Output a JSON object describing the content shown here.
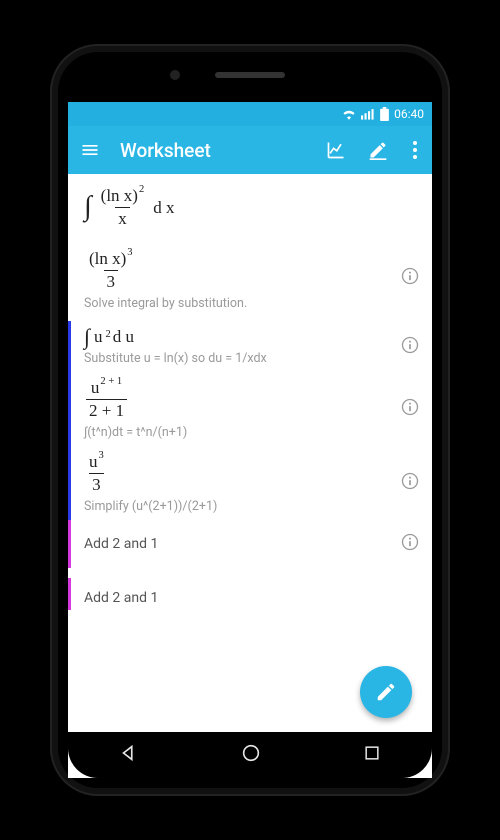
{
  "statusbar": {
    "time": "06:40"
  },
  "appbar": {
    "title": "Worksheet"
  },
  "problem": {
    "int_prefix": "∫",
    "lnx": "(ln x)",
    "exp2": "2",
    "over_x": "x",
    "dx": "d x"
  },
  "answer": {
    "lnx": "(ln x)",
    "exp3": "3",
    "den": "3",
    "hint": "Solve integral by substitution."
  },
  "step1": {
    "int_prefix": "∫",
    "u": "u",
    "exp2": "2",
    "du": "d u",
    "hint": "Substitute u = ln(x) so du = 1/xdx"
  },
  "step2": {
    "u": "u",
    "exp": "2 + 1",
    "den": "2 + 1",
    "hint": "∫(t^n)dt = t^n/(n+1)"
  },
  "step3": {
    "u": "u",
    "exp": "3",
    "den": "3",
    "hint": "Simplify (u^(2+1))/(2+1)"
  },
  "step4": {
    "text": "Add 2 and 1"
  },
  "step5": {
    "text": "Add 2 and 1"
  }
}
